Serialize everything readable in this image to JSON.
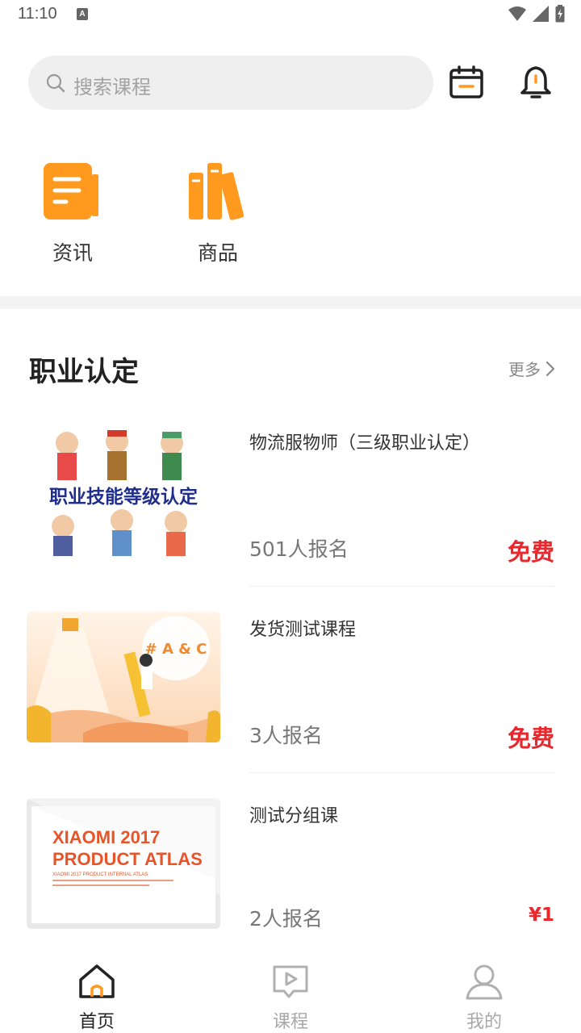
{
  "status_bar": {
    "time": "11:10",
    "notification_badge": "A"
  },
  "search": {
    "placeholder": "搜索课程"
  },
  "quick_links": [
    {
      "label": "资讯",
      "icon": "news-doc-icon"
    },
    {
      "label": "商品",
      "icon": "books-icon"
    }
  ],
  "section": {
    "title": "职业认定",
    "more_label": "更多"
  },
  "courses": [
    {
      "title": "物流服物师（三级职业认定）",
      "enrolled": "501人报名",
      "price": "免费",
      "thumb_text": "职业技能等级认定"
    },
    {
      "title": "发货测试课程",
      "enrolled": "3人报名",
      "price": "免费",
      "thumb_text": "# A & C"
    },
    {
      "title": "测试分组课",
      "enrolled": "2人报名",
      "price": "¥1",
      "thumb_text_line1": "XIAOMI 2017",
      "thumb_text_line2": "PRODUCT ATLAS",
      "thumb_text_small": "XIAOMI 2017 PRODUCT INTERNAL ATLAS"
    }
  ],
  "tabs": [
    {
      "label": "首页",
      "active": true
    },
    {
      "label": "课程",
      "active": false
    },
    {
      "label": "我的",
      "active": false
    }
  ],
  "colors": {
    "accent_orange": "#ff9a1f",
    "price_red": "#e8282d",
    "tab_active": "#222222",
    "tab_inactive": "#a8a8a8"
  }
}
